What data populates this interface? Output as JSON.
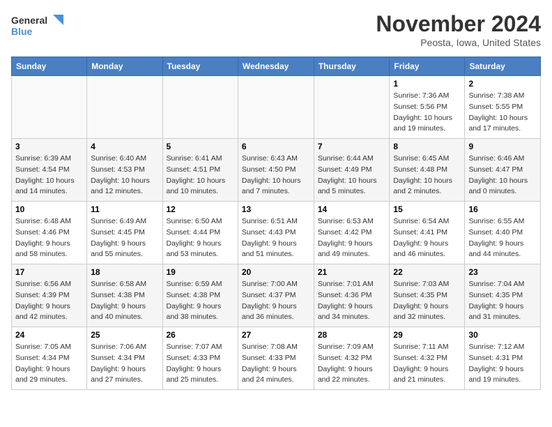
{
  "logo": {
    "line1": "General",
    "line2": "Blue"
  },
  "title": "November 2024",
  "location": "Peosta, Iowa, United States",
  "header": {
    "days": [
      "Sunday",
      "Monday",
      "Tuesday",
      "Wednesday",
      "Thursday",
      "Friday",
      "Saturday"
    ]
  },
  "weeks": [
    [
      {
        "day": "",
        "info": ""
      },
      {
        "day": "",
        "info": ""
      },
      {
        "day": "",
        "info": ""
      },
      {
        "day": "",
        "info": ""
      },
      {
        "day": "",
        "info": ""
      },
      {
        "day": "1",
        "info": "Sunrise: 7:36 AM\nSunset: 5:56 PM\nDaylight: 10 hours and 19 minutes."
      },
      {
        "day": "2",
        "info": "Sunrise: 7:38 AM\nSunset: 5:55 PM\nDaylight: 10 hours and 17 minutes."
      }
    ],
    [
      {
        "day": "3",
        "info": "Sunrise: 6:39 AM\nSunset: 4:54 PM\nDaylight: 10 hours and 14 minutes."
      },
      {
        "day": "4",
        "info": "Sunrise: 6:40 AM\nSunset: 4:53 PM\nDaylight: 10 hours and 12 minutes."
      },
      {
        "day": "5",
        "info": "Sunrise: 6:41 AM\nSunset: 4:51 PM\nDaylight: 10 hours and 10 minutes."
      },
      {
        "day": "6",
        "info": "Sunrise: 6:43 AM\nSunset: 4:50 PM\nDaylight: 10 hours and 7 minutes."
      },
      {
        "day": "7",
        "info": "Sunrise: 6:44 AM\nSunset: 4:49 PM\nDaylight: 10 hours and 5 minutes."
      },
      {
        "day": "8",
        "info": "Sunrise: 6:45 AM\nSunset: 4:48 PM\nDaylight: 10 hours and 2 minutes."
      },
      {
        "day": "9",
        "info": "Sunrise: 6:46 AM\nSunset: 4:47 PM\nDaylight: 10 hours and 0 minutes."
      }
    ],
    [
      {
        "day": "10",
        "info": "Sunrise: 6:48 AM\nSunset: 4:46 PM\nDaylight: 9 hours and 58 minutes."
      },
      {
        "day": "11",
        "info": "Sunrise: 6:49 AM\nSunset: 4:45 PM\nDaylight: 9 hours and 55 minutes."
      },
      {
        "day": "12",
        "info": "Sunrise: 6:50 AM\nSunset: 4:44 PM\nDaylight: 9 hours and 53 minutes."
      },
      {
        "day": "13",
        "info": "Sunrise: 6:51 AM\nSunset: 4:43 PM\nDaylight: 9 hours and 51 minutes."
      },
      {
        "day": "14",
        "info": "Sunrise: 6:53 AM\nSunset: 4:42 PM\nDaylight: 9 hours and 49 minutes."
      },
      {
        "day": "15",
        "info": "Sunrise: 6:54 AM\nSunset: 4:41 PM\nDaylight: 9 hours and 46 minutes."
      },
      {
        "day": "16",
        "info": "Sunrise: 6:55 AM\nSunset: 4:40 PM\nDaylight: 9 hours and 44 minutes."
      }
    ],
    [
      {
        "day": "17",
        "info": "Sunrise: 6:56 AM\nSunset: 4:39 PM\nDaylight: 9 hours and 42 minutes."
      },
      {
        "day": "18",
        "info": "Sunrise: 6:58 AM\nSunset: 4:38 PM\nDaylight: 9 hours and 40 minutes."
      },
      {
        "day": "19",
        "info": "Sunrise: 6:59 AM\nSunset: 4:38 PM\nDaylight: 9 hours and 38 minutes."
      },
      {
        "day": "20",
        "info": "Sunrise: 7:00 AM\nSunset: 4:37 PM\nDaylight: 9 hours and 36 minutes."
      },
      {
        "day": "21",
        "info": "Sunrise: 7:01 AM\nSunset: 4:36 PM\nDaylight: 9 hours and 34 minutes."
      },
      {
        "day": "22",
        "info": "Sunrise: 7:03 AM\nSunset: 4:35 PM\nDaylight: 9 hours and 32 minutes."
      },
      {
        "day": "23",
        "info": "Sunrise: 7:04 AM\nSunset: 4:35 PM\nDaylight: 9 hours and 31 minutes."
      }
    ],
    [
      {
        "day": "24",
        "info": "Sunrise: 7:05 AM\nSunset: 4:34 PM\nDaylight: 9 hours and 29 minutes."
      },
      {
        "day": "25",
        "info": "Sunrise: 7:06 AM\nSunset: 4:34 PM\nDaylight: 9 hours and 27 minutes."
      },
      {
        "day": "26",
        "info": "Sunrise: 7:07 AM\nSunset: 4:33 PM\nDaylight: 9 hours and 25 minutes."
      },
      {
        "day": "27",
        "info": "Sunrise: 7:08 AM\nSunset: 4:33 PM\nDaylight: 9 hours and 24 minutes."
      },
      {
        "day": "28",
        "info": "Sunrise: 7:09 AM\nSunset: 4:32 PM\nDaylight: 9 hours and 22 minutes."
      },
      {
        "day": "29",
        "info": "Sunrise: 7:11 AM\nSunset: 4:32 PM\nDaylight: 9 hours and 21 minutes."
      },
      {
        "day": "30",
        "info": "Sunrise: 7:12 AM\nSunset: 4:31 PM\nDaylight: 9 hours and 19 minutes."
      }
    ]
  ]
}
